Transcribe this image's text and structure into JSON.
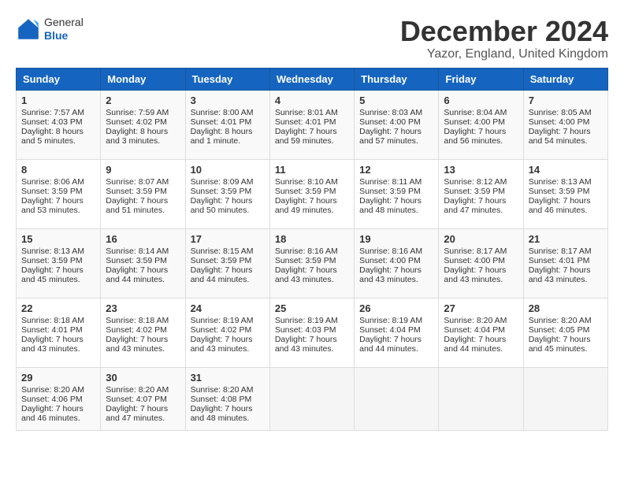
{
  "header": {
    "logo_line1": "General",
    "logo_line2": "Blue",
    "title": "December 2024",
    "location": "Yazor, England, United Kingdom"
  },
  "weekdays": [
    "Sunday",
    "Monday",
    "Tuesday",
    "Wednesday",
    "Thursday",
    "Friday",
    "Saturday"
  ],
  "weeks": [
    [
      {
        "day": "1",
        "lines": [
          "Sunrise: 7:57 AM",
          "Sunset: 4:03 PM",
          "Daylight: 8 hours",
          "and 5 minutes."
        ]
      },
      {
        "day": "2",
        "lines": [
          "Sunrise: 7:59 AM",
          "Sunset: 4:02 PM",
          "Daylight: 8 hours",
          "and 3 minutes."
        ]
      },
      {
        "day": "3",
        "lines": [
          "Sunrise: 8:00 AM",
          "Sunset: 4:01 PM",
          "Daylight: 8 hours",
          "and 1 minute."
        ]
      },
      {
        "day": "4",
        "lines": [
          "Sunrise: 8:01 AM",
          "Sunset: 4:01 PM",
          "Daylight: 7 hours",
          "and 59 minutes."
        ]
      },
      {
        "day": "5",
        "lines": [
          "Sunrise: 8:03 AM",
          "Sunset: 4:00 PM",
          "Daylight: 7 hours",
          "and 57 minutes."
        ]
      },
      {
        "day": "6",
        "lines": [
          "Sunrise: 8:04 AM",
          "Sunset: 4:00 PM",
          "Daylight: 7 hours",
          "and 56 minutes."
        ]
      },
      {
        "day": "7",
        "lines": [
          "Sunrise: 8:05 AM",
          "Sunset: 4:00 PM",
          "Daylight: 7 hours",
          "and 54 minutes."
        ]
      }
    ],
    [
      {
        "day": "8",
        "lines": [
          "Sunrise: 8:06 AM",
          "Sunset: 3:59 PM",
          "Daylight: 7 hours",
          "and 53 minutes."
        ]
      },
      {
        "day": "9",
        "lines": [
          "Sunrise: 8:07 AM",
          "Sunset: 3:59 PM",
          "Daylight: 7 hours",
          "and 51 minutes."
        ]
      },
      {
        "day": "10",
        "lines": [
          "Sunrise: 8:09 AM",
          "Sunset: 3:59 PM",
          "Daylight: 7 hours",
          "and 50 minutes."
        ]
      },
      {
        "day": "11",
        "lines": [
          "Sunrise: 8:10 AM",
          "Sunset: 3:59 PM",
          "Daylight: 7 hours",
          "and 49 minutes."
        ]
      },
      {
        "day": "12",
        "lines": [
          "Sunrise: 8:11 AM",
          "Sunset: 3:59 PM",
          "Daylight: 7 hours",
          "and 48 minutes."
        ]
      },
      {
        "day": "13",
        "lines": [
          "Sunrise: 8:12 AM",
          "Sunset: 3:59 PM",
          "Daylight: 7 hours",
          "and 47 minutes."
        ]
      },
      {
        "day": "14",
        "lines": [
          "Sunrise: 8:13 AM",
          "Sunset: 3:59 PM",
          "Daylight: 7 hours",
          "and 46 minutes."
        ]
      }
    ],
    [
      {
        "day": "15",
        "lines": [
          "Sunrise: 8:13 AM",
          "Sunset: 3:59 PM",
          "Daylight: 7 hours",
          "and 45 minutes."
        ]
      },
      {
        "day": "16",
        "lines": [
          "Sunrise: 8:14 AM",
          "Sunset: 3:59 PM",
          "Daylight: 7 hours",
          "and 44 minutes."
        ]
      },
      {
        "day": "17",
        "lines": [
          "Sunrise: 8:15 AM",
          "Sunset: 3:59 PM",
          "Daylight: 7 hours",
          "and 44 minutes."
        ]
      },
      {
        "day": "18",
        "lines": [
          "Sunrise: 8:16 AM",
          "Sunset: 3:59 PM",
          "Daylight: 7 hours",
          "and 43 minutes."
        ]
      },
      {
        "day": "19",
        "lines": [
          "Sunrise: 8:16 AM",
          "Sunset: 4:00 PM",
          "Daylight: 7 hours",
          "and 43 minutes."
        ]
      },
      {
        "day": "20",
        "lines": [
          "Sunrise: 8:17 AM",
          "Sunset: 4:00 PM",
          "Daylight: 7 hours",
          "and 43 minutes."
        ]
      },
      {
        "day": "21",
        "lines": [
          "Sunrise: 8:17 AM",
          "Sunset: 4:01 PM",
          "Daylight: 7 hours",
          "and 43 minutes."
        ]
      }
    ],
    [
      {
        "day": "22",
        "lines": [
          "Sunrise: 8:18 AM",
          "Sunset: 4:01 PM",
          "Daylight: 7 hours",
          "and 43 minutes."
        ]
      },
      {
        "day": "23",
        "lines": [
          "Sunrise: 8:18 AM",
          "Sunset: 4:02 PM",
          "Daylight: 7 hours",
          "and 43 minutes."
        ]
      },
      {
        "day": "24",
        "lines": [
          "Sunrise: 8:19 AM",
          "Sunset: 4:02 PM",
          "Daylight: 7 hours",
          "and 43 minutes."
        ]
      },
      {
        "day": "25",
        "lines": [
          "Sunrise: 8:19 AM",
          "Sunset: 4:03 PM",
          "Daylight: 7 hours",
          "and 43 minutes."
        ]
      },
      {
        "day": "26",
        "lines": [
          "Sunrise: 8:19 AM",
          "Sunset: 4:04 PM",
          "Daylight: 7 hours",
          "and 44 minutes."
        ]
      },
      {
        "day": "27",
        "lines": [
          "Sunrise: 8:20 AM",
          "Sunset: 4:04 PM",
          "Daylight: 7 hours",
          "and 44 minutes."
        ]
      },
      {
        "day": "28",
        "lines": [
          "Sunrise: 8:20 AM",
          "Sunset: 4:05 PM",
          "Daylight: 7 hours",
          "and 45 minutes."
        ]
      }
    ],
    [
      {
        "day": "29",
        "lines": [
          "Sunrise: 8:20 AM",
          "Sunset: 4:06 PM",
          "Daylight: 7 hours",
          "and 46 minutes."
        ]
      },
      {
        "day": "30",
        "lines": [
          "Sunrise: 8:20 AM",
          "Sunset: 4:07 PM",
          "Daylight: 7 hours",
          "and 47 minutes."
        ]
      },
      {
        "day": "31",
        "lines": [
          "Sunrise: 8:20 AM",
          "Sunset: 4:08 PM",
          "Daylight: 7 hours",
          "and 48 minutes."
        ]
      },
      {
        "day": "",
        "lines": []
      },
      {
        "day": "",
        "lines": []
      },
      {
        "day": "",
        "lines": []
      },
      {
        "day": "",
        "lines": []
      }
    ]
  ]
}
